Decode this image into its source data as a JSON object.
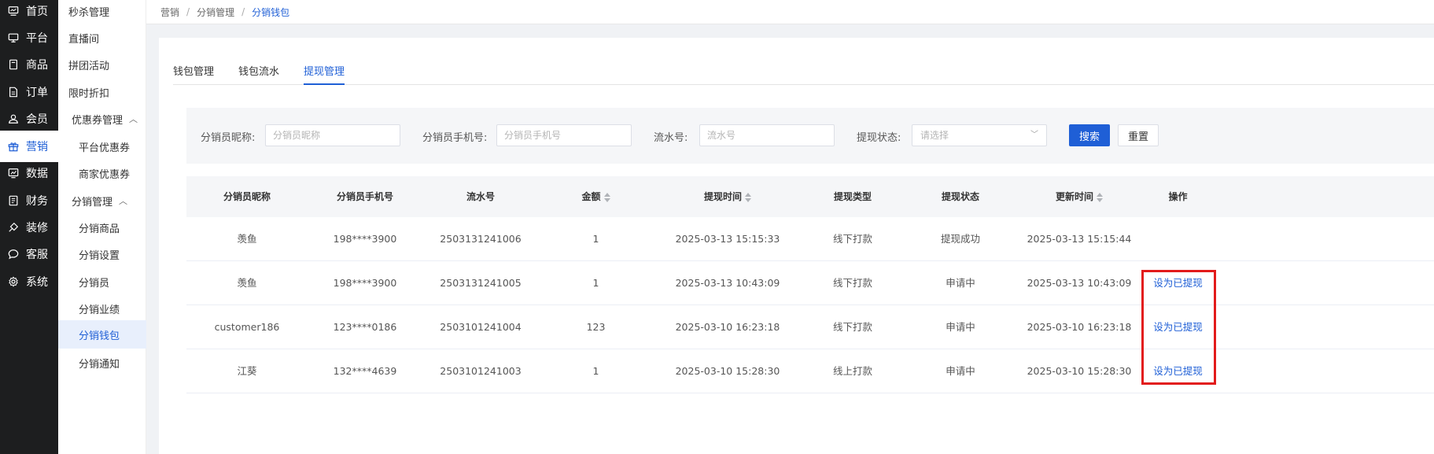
{
  "nav": [
    {
      "label": "首页",
      "icon": "monitor-icon"
    },
    {
      "label": "平台",
      "icon": "display-icon"
    },
    {
      "label": "商品",
      "icon": "box-icon"
    },
    {
      "label": "订单",
      "icon": "document-icon"
    },
    {
      "label": "会员",
      "icon": "users-icon"
    },
    {
      "label": "营销",
      "icon": "gift-icon"
    },
    {
      "label": "数据",
      "icon": "chart-icon"
    },
    {
      "label": "财务",
      "icon": "ledger-icon"
    },
    {
      "label": "装修",
      "icon": "brush-icon"
    },
    {
      "label": "客服",
      "icon": "chat-icon"
    },
    {
      "label": "系统",
      "icon": "gear-icon"
    }
  ],
  "submenu": {
    "items": [
      "秒杀管理",
      "直播间",
      "拼团活动",
      "限时折扣"
    ],
    "coupon_group": "优惠券管理",
    "coupon_items": [
      "平台优惠券",
      "商家优惠券"
    ],
    "distribution_group": "分销管理",
    "distribution_items": [
      "分销商品",
      "分销设置",
      "分销员",
      "分销业绩",
      "分销钱包",
      "分销通知"
    ]
  },
  "breadcrumb": [
    "营销",
    "分销管理",
    "分销钱包"
  ],
  "tabs": [
    "钱包管理",
    "钱包流水",
    "提现管理"
  ],
  "filters": {
    "nickname_label": "分销员昵称:",
    "nickname_placeholder": "分销员昵称",
    "phone_label": "分销员手机号:",
    "phone_placeholder": "分销员手机号",
    "serial_label": "流水号:",
    "serial_placeholder": "流水号",
    "status_label": "提现状态:",
    "status_placeholder": "请选择",
    "search_label": "搜索",
    "reset_label": "重置"
  },
  "table": {
    "columns": [
      "分销员昵称",
      "分销员手机号",
      "流水号",
      "金额",
      "提现时间",
      "提现类型",
      "提现状态",
      "更新时间",
      "操作"
    ],
    "rows": [
      [
        "羡鱼",
        "198****3900",
        "2503131241006",
        "1",
        "2025-03-13 15:15:33",
        "线下打款",
        "提现成功",
        "2025-03-13 15:15:44",
        ""
      ],
      [
        "羡鱼",
        "198****3900",
        "2503131241005",
        "1",
        "2025-03-13 10:43:09",
        "线下打款",
        "申请中",
        "2025-03-13 10:43:09",
        "设为已提现"
      ],
      [
        "customer186",
        "123****0186",
        "2503101241004",
        "123",
        "2025-03-10 16:23:18",
        "线下打款",
        "申请中",
        "2025-03-10 16:23:18",
        "设为已提现"
      ],
      [
        "江葵",
        "132****4639",
        "2503101241003",
        "1",
        "2025-03-10 15:28:30",
        "线上打款",
        "申请中",
        "2025-03-10 15:28:30",
        "设为已提现"
      ]
    ]
  },
  "colors": {
    "accent": "#1f5fd6",
    "highlight": "#e21b1b",
    "nav_bg": "#1d1e1f"
  }
}
